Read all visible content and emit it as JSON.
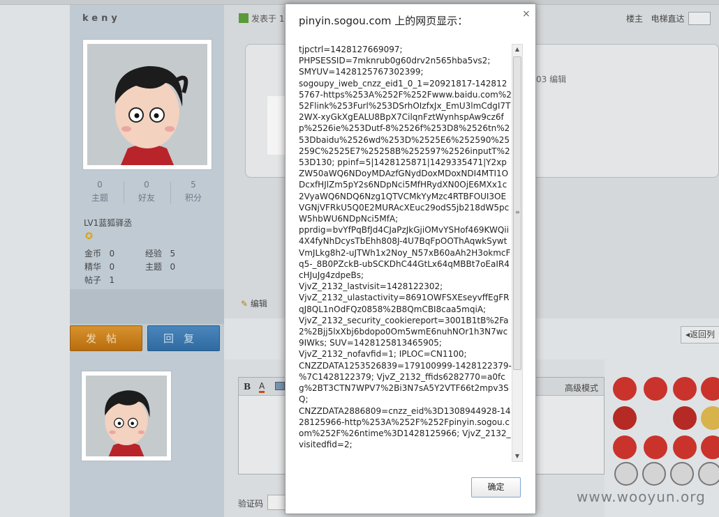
{
  "dialog": {
    "title": "pinyin.sogou.com 上的网页显示：",
    "close": "×",
    "message": "tjpctrl=1428127669097;\nPHPSESSID=7mknrub0g60drv2n565hba5vs2;\nSMYUV=1428125767302399;\nsogoupy_iweb_cnzz_eid1_0_1=20921817-1428125767-https%253A%252F%252Fwww.baidu.com%252Flink%253Furl%253DSrhOIzfxJx_EmU3lmCdgI7T2WX-xyGkXgEALU8BpX7CilqnFztWynhspAw9cz6fp%2526ie%253Dutf-8%2526f%253D8%2526tn%253Dbaidu%2526wd%253D%2525E6%252590%25259C%2525E7%25258B%252597%2526inputT%253D130; ppinf=5|1428125871|1429335471|Y2xpZW50aWQ6NDoyMDAzfGNydDoxMDoxNDI4MTI1ODcxfHJlZm5pY2s6NDpNci5MfHRydXN0OjE6MXx1c2VyaWQ6NDQ6Nzg1QTVCMkYyMzc4RTBFOUI3OEVGNjVFRkU5Q0E2MURAcXEuc29odS5jb218dW5pcW5hbWU6NDpNci5MfA;\npprdig=bvYfPqBfJd4CJaPzJkGjiOMvYSHof469KWQii4X4fyNhDcysTbEhh808J-4U7BqFpOOThAqwkSywtVmJLkg8h2-uJTWh1x2Noy_N57xB60aAh2H3okmcFq5-_8B0PZckB-ubSCKDhC44GtLx64qMBBt7oEaIR4cHJuJg4zdpeBs;\nVjvZ_2132_lastvisit=1428122302;\nVjvZ_2132_ulastactivity=8691OWFSXEseyvffEgFRqJ8QL1nOdFQz0858%2B8QmCBI8caa5mqiA;\nVjvZ_2132_security_cookiereport=3001B1tB%2Fa2%2Bjj5lxXbj6bdopo0Om5wmE6nuhNOr1h3N7wc9IWks; SUV=1428125813465905;\nVjvZ_2132_nofavfid=1; IPLOC=CN1100;\nCNZZDATA1253526839=179100999-1428122379-%7C1428122379; VjvZ_2132_ffids6282770=a0fcg%2BT3CTN7WPV7%2Bi3N7sA5Y2VTF66t2mpv3SQ;\nCNZZDATA2886809=cnzz_eid%3D1308944928-1428125966-http%253A%252F%252Fpinyin.sogou.com%252F%26ntime%3D1428125966; VjvZ_2132_visitedfid=2;",
    "ok_label": "确定"
  },
  "profile": {
    "username": "keny",
    "stats": [
      {
        "value": "0",
        "label": "主题"
      },
      {
        "value": "0",
        "label": "好友"
      },
      {
        "value": "5",
        "label": "积分"
      }
    ],
    "level": "LV1蓝狐驿丞",
    "info": [
      {
        "key": "金币",
        "value": "0"
      },
      {
        "key": "经验",
        "value": "5"
      },
      {
        "key": "精华",
        "value": "0"
      },
      {
        "key": "主题",
        "value": "0"
      },
      {
        "key": "帖子",
        "value": "1"
      }
    ]
  },
  "post": {
    "posted_prefix": "发表于 1",
    "time_fragment": ":03",
    "edit_fragment": "编辑",
    "floor_label": "楼主",
    "jump_label": "电梯直达",
    "edit_link": "编辑"
  },
  "actions": {
    "post_button": "发帖",
    "reply_button": "回复",
    "return_button": "返回列"
  },
  "editor": {
    "bold_icon": "B",
    "color_icon": "A",
    "advanced_mode": "高级模式"
  },
  "captcha": {
    "label": "验证码"
  },
  "watermark": "www.wooyun.org",
  "colors": {
    "post_button": "#c77f1c",
    "reply_button": "#3b78ae",
    "ok_border": "#7fa6d6"
  }
}
